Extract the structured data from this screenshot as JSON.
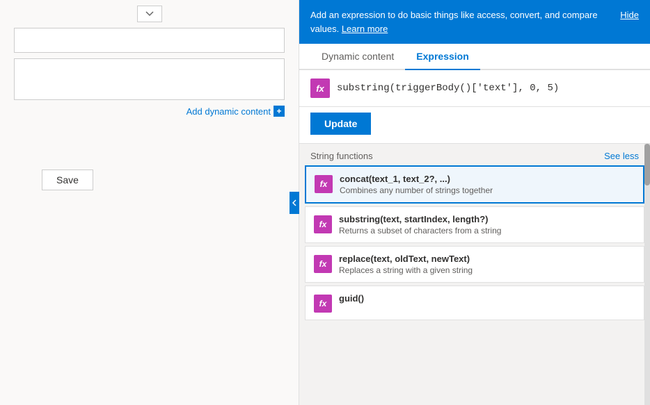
{
  "left": {
    "add_dynamic_label": "Add dynamic content",
    "add_dynamic_plus": "+",
    "save_label": "Save"
  },
  "right": {
    "info_bar": {
      "text": "Add an expression to do basic things like access, convert, and compare values.",
      "learn_more": "Learn more",
      "hide_label": "Hide"
    },
    "tabs": [
      {
        "id": "dynamic",
        "label": "Dynamic content",
        "active": false
      },
      {
        "id": "expression",
        "label": "Expression",
        "active": true
      }
    ],
    "expression": {
      "fx_label": "fx",
      "value": "substring(triggerBody()['text'], 0, 5)"
    },
    "update_button": "Update",
    "section": {
      "title": "String functions",
      "see_less": "See less"
    },
    "functions": [
      {
        "id": "concat",
        "name": "concat(text_1, text_2?, ...)",
        "desc": "Combines any number of strings together",
        "selected": true
      },
      {
        "id": "substring",
        "name": "substring(text, startIndex, length?)",
        "desc": "Returns a subset of characters from a string",
        "selected": false
      },
      {
        "id": "replace",
        "name": "replace(text, oldText, newText)",
        "desc": "Replaces a string with a given string",
        "selected": false
      },
      {
        "id": "guid",
        "name": "guid()",
        "desc": "",
        "selected": false
      }
    ]
  }
}
